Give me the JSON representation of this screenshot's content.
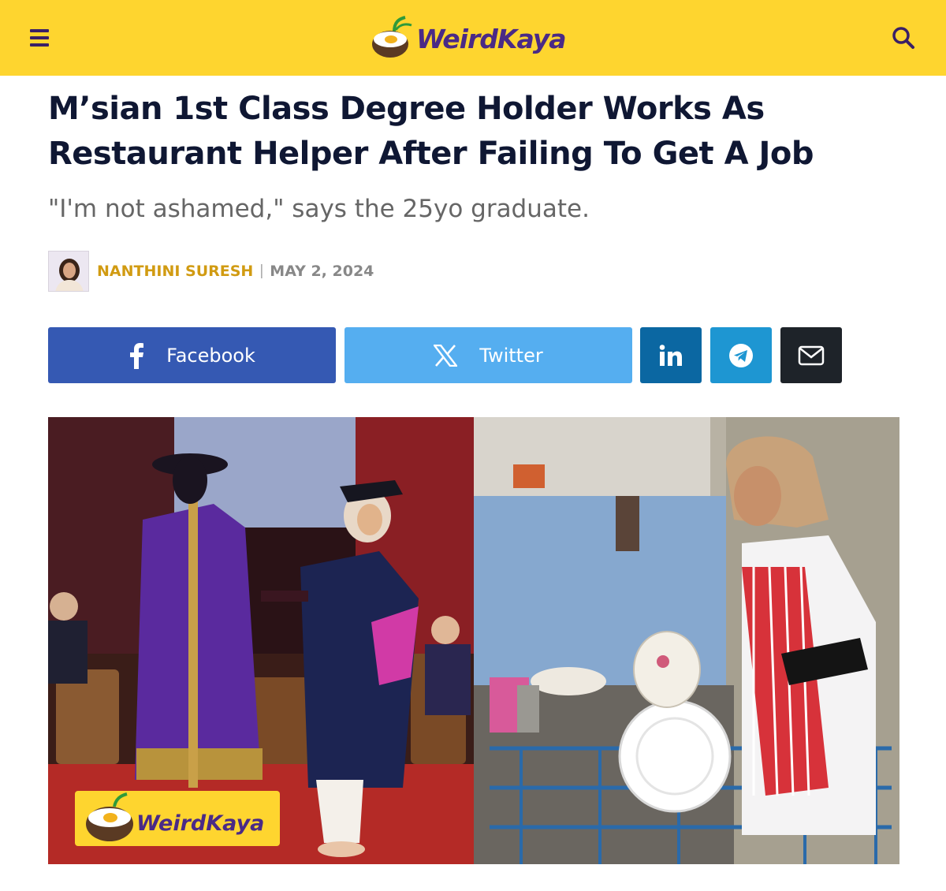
{
  "site": {
    "name": "WeirdKaya",
    "colors": {
      "header_bg": "#fed52f",
      "brand_purple": "#4a2a86",
      "author_gold": "#d19b12"
    }
  },
  "article": {
    "headline": "M’sian 1st Class Degree Holder Works As Restaurant Helper After Failing To Get A Job",
    "subheadline": "\"I'm not ashamed,\" says the 25yo graduate.",
    "author": "NANTHINI SURESH",
    "separator": "|",
    "date": "MAY 2, 2024"
  },
  "share": {
    "facebook": {
      "label": "Facebook",
      "icon": "facebook-icon",
      "color": "#3559b3"
    },
    "twitter": {
      "label": "Twitter",
      "icon": "x-icon",
      "color": "#55aef0"
    },
    "linkedin": {
      "icon": "linkedin-icon",
      "color": "#0b67a2"
    },
    "telegram": {
      "icon": "telegram-icon",
      "color": "#1e96d2"
    },
    "email": {
      "icon": "envelope-icon",
      "color": "#1e2329"
    }
  },
  "hero": {
    "watermark": "WeirdKaya"
  }
}
